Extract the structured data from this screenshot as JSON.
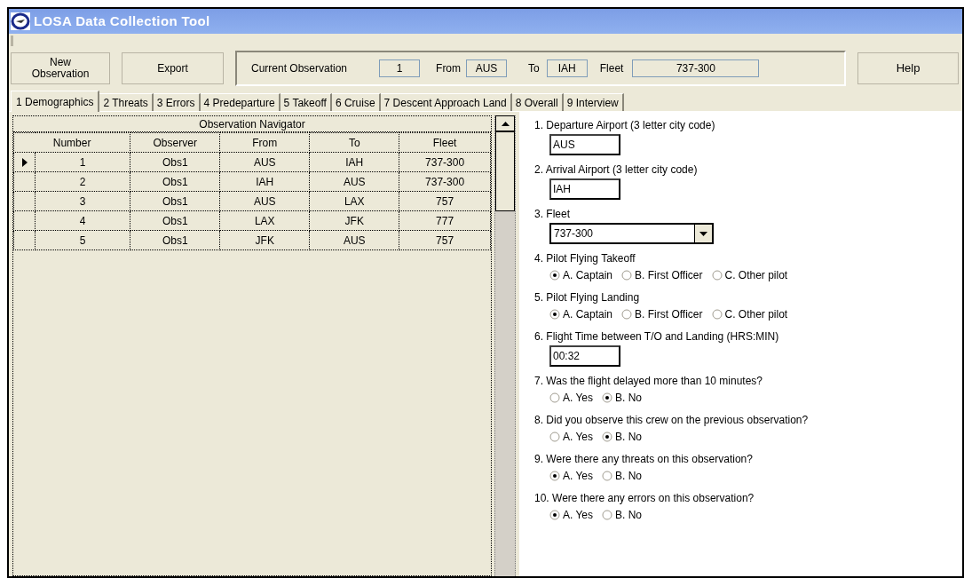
{
  "window": {
    "title": "LOSA Data Collection Tool"
  },
  "toolbar": {
    "buttons": [
      {
        "label": "New\nObservation"
      },
      {
        "label": "Export"
      }
    ],
    "current": {
      "label": "Current Observation",
      "value": "1",
      "from_label": "From",
      "from": "AUS",
      "to_label": "To",
      "to": "IAH",
      "fleet_label": "Fleet",
      "fleet": "737-300"
    },
    "help": "Help"
  },
  "tabs": [
    {
      "label": "1 Demographics",
      "selected": true
    },
    {
      "label": "2 Threats",
      "selected": false
    },
    {
      "label": "3 Errors",
      "selected": false
    },
    {
      "label": "4 Predeparture",
      "selected": false
    },
    {
      "label": "5 Takeoff",
      "selected": false
    },
    {
      "label": "6 Cruise",
      "selected": false
    },
    {
      "label": "7 Descent Approach Land",
      "selected": false
    },
    {
      "label": "8 Overall",
      "selected": false
    },
    {
      "label": "9 Interview",
      "selected": false
    }
  ],
  "navigator": {
    "title": "Observation Navigator",
    "columns": [
      "Number",
      "Observer",
      "From",
      "To",
      "Fleet"
    ],
    "rows": [
      {
        "cells": [
          "1",
          "Obs1",
          "AUS",
          "IAH",
          "737-300"
        ],
        "selected": true
      },
      {
        "cells": [
          "2",
          "Obs1",
          "IAH",
          "AUS",
          "737-300"
        ],
        "selected": false
      },
      {
        "cells": [
          "3",
          "Obs1",
          "AUS",
          "LAX",
          "757"
        ],
        "selected": false
      },
      {
        "cells": [
          "4",
          "Obs1",
          "LAX",
          "JFK",
          "777"
        ],
        "selected": false
      },
      {
        "cells": [
          "5",
          "Obs1",
          "JFK",
          "AUS",
          "757"
        ],
        "selected": false
      }
    ]
  },
  "questions": [
    {
      "kind": "text",
      "label": "1. Departure Airport (3 letter city code)",
      "value": "AUS"
    },
    {
      "kind": "text",
      "label": "2. Arrival Airport (3 letter city code)",
      "value": "IAH"
    },
    {
      "kind": "dropdown",
      "label": "3. Fleet",
      "value": "737-300"
    },
    {
      "kind": "radio",
      "label": "4. Pilot Flying Takeoff",
      "options": [
        {
          "label": "A. Captain",
          "selected": true
        },
        {
          "label": "B. First Officer",
          "selected": false
        },
        {
          "label": "C. Other pilot",
          "selected": false
        }
      ]
    },
    {
      "kind": "radio",
      "label": "5. Pilot Flying Landing",
      "options": [
        {
          "label": "A. Captain",
          "selected": true
        },
        {
          "label": "B. First Officer",
          "selected": false
        },
        {
          "label": "C. Other pilot",
          "selected": false
        }
      ]
    },
    {
      "kind": "text",
      "label": "6. Flight Time between T/O and Landing (HRS:MIN)",
      "value": "00:32"
    },
    {
      "kind": "radio",
      "label": "7. Was the flight delayed more than 10 minutes?",
      "options": [
        {
          "label": "A. Yes",
          "selected": false
        },
        {
          "label": "B. No",
          "selected": true
        }
      ]
    },
    {
      "kind": "radio",
      "label": "8. Did you observe this crew on the previous observation?",
      "options": [
        {
          "label": "A. Yes",
          "selected": false
        },
        {
          "label": "B. No",
          "selected": true
        }
      ]
    },
    {
      "kind": "radio",
      "label": "9. Were there any threats on this observation?",
      "options": [
        {
          "label": "A. Yes",
          "selected": true
        },
        {
          "label": "B. No",
          "selected": false
        }
      ]
    },
    {
      "kind": "radio",
      "label": "10. Were there any errors on this observation?",
      "options": [
        {
          "label": "A. Yes",
          "selected": true
        },
        {
          "label": "B. No",
          "selected": false
        }
      ]
    }
  ]
}
